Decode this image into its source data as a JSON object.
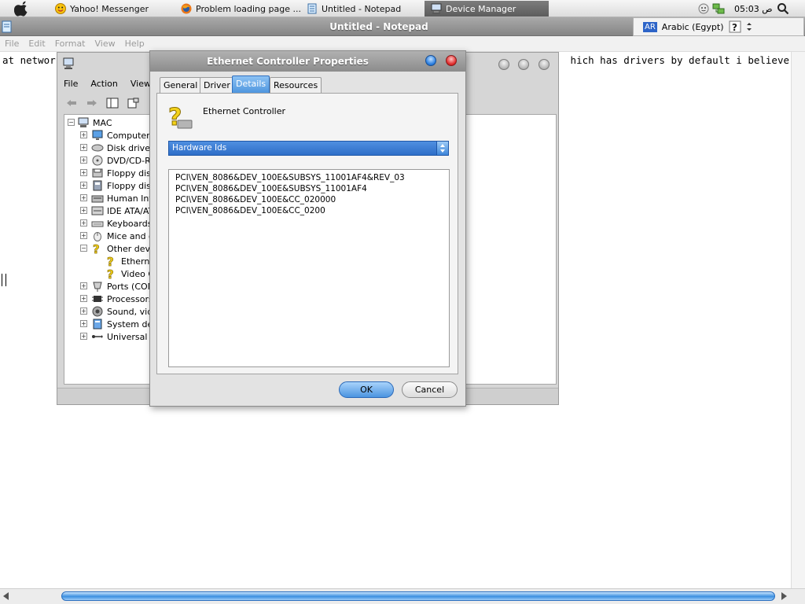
{
  "taskbar": {
    "tasks": [
      {
        "label": "Yahoo! Messenger",
        "icon": "yahoo-smiley-icon"
      },
      {
        "label": "Problem loading page ...",
        "icon": "firefox-icon"
      },
      {
        "label": "Untitled - Notepad",
        "icon": "notepad-icon"
      },
      {
        "label": "Device Manager",
        "icon": "computer-icon",
        "active": true
      }
    ],
    "clock": "05:03 ص"
  },
  "notepad": {
    "title": "Untitled - Notepad",
    "menu": [
      "File",
      "Edit",
      "Format",
      "View",
      "Help"
    ],
    "text_left": "at networ",
    "text_right": "hich has drivers by default i believe"
  },
  "language_bar": {
    "code": "AR",
    "language": "Arabic (Egypt)"
  },
  "device_manager": {
    "menu": [
      "File",
      "Action",
      "View"
    ],
    "tree": {
      "root": "MAC",
      "items": [
        {
          "label": "Computer",
          "icon": "monitor-icon"
        },
        {
          "label": "Disk drives",
          "icon": "disk-drive-icon"
        },
        {
          "label": "DVD/CD-RO",
          "icon": "cdrom-icon"
        },
        {
          "label": "Floppy disk",
          "icon": "floppy-icon"
        },
        {
          "label": "Floppy disk",
          "icon": "floppy-controller-icon"
        },
        {
          "label": "Human Inte",
          "icon": "hid-icon"
        },
        {
          "label": "IDE ATA/AT",
          "icon": "ide-icon"
        },
        {
          "label": "Keyboards",
          "icon": "keyboard-icon"
        },
        {
          "label": "Mice and ot",
          "icon": "mouse-icon"
        },
        {
          "label": "Other devic",
          "icon": "unknown-device-icon",
          "expanded": true,
          "children": [
            {
              "label": "Etherne",
              "icon": "unknown-device-icon"
            },
            {
              "label": "Video C",
              "icon": "unknown-device-icon"
            }
          ]
        },
        {
          "label": "Ports (COM",
          "icon": "port-icon"
        },
        {
          "label": "Processors",
          "icon": "processor-icon"
        },
        {
          "label": "Sound, vide",
          "icon": "sound-icon"
        },
        {
          "label": "System dev",
          "icon": "system-icon"
        },
        {
          "label": "Universal S",
          "icon": "usb-icon"
        }
      ]
    }
  },
  "dialog": {
    "title": "Ethernet Controller Properties",
    "tabs": [
      {
        "label": "General"
      },
      {
        "label": "Driver"
      },
      {
        "label": "Details",
        "selected": true
      },
      {
        "label": "Resources"
      }
    ],
    "device_name": "Ethernet Controller",
    "property_select": "Hardware Ids",
    "values": [
      "PCI\\VEN_8086&DEV_100E&SUBSYS_11001AF4&REV_03",
      "PCI\\VEN_8086&DEV_100E&SUBSYS_11001AF4",
      "PCI\\VEN_8086&DEV_100E&CC_020000",
      "PCI\\VEN_8086&DEV_100E&CC_0200"
    ],
    "ok_label": "OK",
    "cancel_label": "Cancel"
  }
}
